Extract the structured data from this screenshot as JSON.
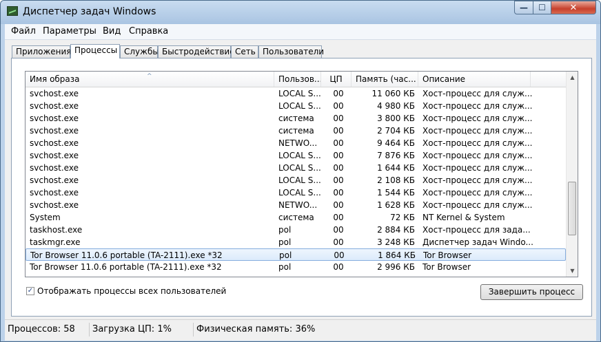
{
  "window": {
    "title": "Диспетчер задач Windows",
    "min_glyph": "—",
    "max_glyph": "☐",
    "close_glyph": "✕"
  },
  "menu": [
    "Файл",
    "Параметры",
    "Вид",
    "Справка"
  ],
  "tabs": [
    "Приложения",
    "Процессы",
    "Службы",
    "Быстродействие",
    "Сеть",
    "Пользователи"
  ],
  "active_tab": "Процессы",
  "columns": [
    "Имя образа",
    "Пользов...",
    "ЦП",
    "Память (час...",
    "Описание"
  ],
  "sort_glyph": "^",
  "rows": [
    {
      "name": "svchost.exe",
      "user": "LOCAL S...",
      "cpu": "00",
      "mem": "11 060 КБ",
      "desc": "Хост-процесс для служ..."
    },
    {
      "name": "svchost.exe",
      "user": "LOCAL S...",
      "cpu": "00",
      "mem": "4 980 КБ",
      "desc": "Хост-процесс для служ..."
    },
    {
      "name": "svchost.exe",
      "user": "система",
      "cpu": "00",
      "mem": "3 800 КБ",
      "desc": "Хост-процесс для служ..."
    },
    {
      "name": "svchost.exe",
      "user": "система",
      "cpu": "00",
      "mem": "2 704 КБ",
      "desc": "Хост-процесс для служ..."
    },
    {
      "name": "svchost.exe",
      "user": "NETWO...",
      "cpu": "00",
      "mem": "9 464 КБ",
      "desc": "Хост-процесс для служ..."
    },
    {
      "name": "svchost.exe",
      "user": "LOCAL S...",
      "cpu": "00",
      "mem": "7 876 КБ",
      "desc": "Хост-процесс для служ..."
    },
    {
      "name": "svchost.exe",
      "user": "LOCAL S...",
      "cpu": "00",
      "mem": "1 644 КБ",
      "desc": "Хост-процесс для служ..."
    },
    {
      "name": "svchost.exe",
      "user": "LOCAL S...",
      "cpu": "00",
      "mem": "2 108 КБ",
      "desc": "Хост-процесс для служ..."
    },
    {
      "name": "svchost.exe",
      "user": "LOCAL S...",
      "cpu": "00",
      "mem": "1 544 КБ",
      "desc": "Хост-процесс для служ..."
    },
    {
      "name": "svchost.exe",
      "user": "NETWO...",
      "cpu": "00",
      "mem": "1 628 КБ",
      "desc": "Хост-процесс для служ..."
    },
    {
      "name": "System",
      "user": "система",
      "cpu": "00",
      "mem": "72 КБ",
      "desc": "NT Kernel & System"
    },
    {
      "name": "taskhost.exe",
      "user": "pol",
      "cpu": "00",
      "mem": "2 884 КБ",
      "desc": "Хост-процесс для зада..."
    },
    {
      "name": "taskmgr.exe",
      "user": "pol",
      "cpu": "00",
      "mem": "3 248 КБ",
      "desc": "Диспетчер задач Windo..."
    },
    {
      "name": "Tor Browser 11.0.6 portable (TA-2111).exe *32",
      "user": "pol",
      "cpu": "00",
      "mem": "1 864 КБ",
      "desc": "Tor Browser",
      "selected": true
    },
    {
      "name": "Tor Browser 11.0.6 portable (TA-2111).exe *32",
      "user": "pol",
      "cpu": "00",
      "mem": "2 996 КБ",
      "desc": "Tor Browser"
    }
  ],
  "scrollbar": {
    "up_glyph": "▲",
    "down_glyph": "▼"
  },
  "show_all_users": {
    "label": "Отображать процессы всех пользователей",
    "checked": true,
    "check_glyph": "✓"
  },
  "end_process_label": "Завершить процесс",
  "status": {
    "processes": "Процессов: 58",
    "cpu": "Загрузка ЦП: 1%",
    "memory": "Физическая память: 36%"
  }
}
